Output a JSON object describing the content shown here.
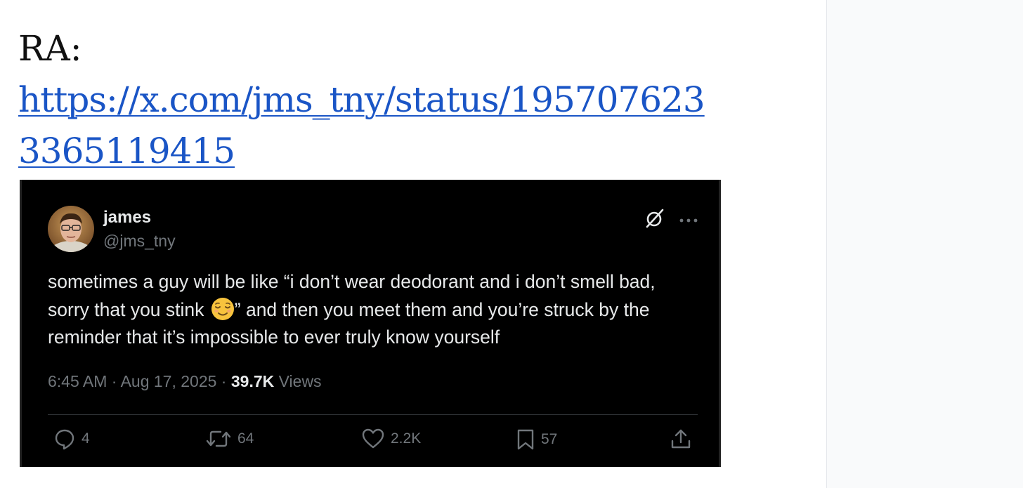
{
  "heading": {
    "label": "RA:",
    "link_text": "https://x.com/jms_tny/status/1957076233365119415"
  },
  "tweet": {
    "author": {
      "name": "james",
      "handle": "@jms_tny",
      "avatar_icon": "profile-photo"
    },
    "text_before_emoji": "sometimes a guy will be like “i don’t wear deodorant and i don’t smell bad, sorry that you stink ",
    "emoji": "relieved-face",
    "text_after_emoji": "” and then you meet them and you’re struck by the reminder that it’s impossible to ever truly know yourself",
    "meta": {
      "time": "6:45 AM",
      "separator": " · ",
      "date": "Aug 17, 2025",
      "views_count": "39.7K",
      "views_label": "Views"
    },
    "actions": {
      "replies": "4",
      "reposts": "64",
      "likes": "2.2K",
      "bookmarks": "57"
    }
  },
  "colors": {
    "link": "#1a55c6",
    "tweet_bg": "#000000",
    "tweet_text": "#e7e9ea",
    "muted": "#71767b"
  }
}
